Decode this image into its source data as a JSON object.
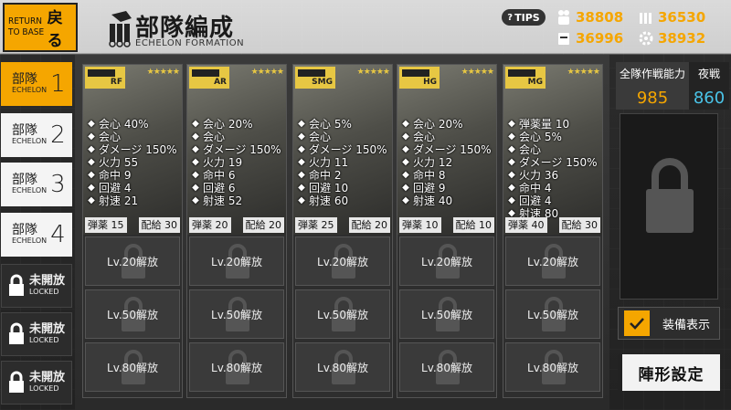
{
  "header": {
    "return_en": "RETURN TO BASE",
    "return_jp": "戻る",
    "title_jp": "部隊編成",
    "title_en": "ECHELON FORMATION",
    "tips": "TIPS"
  },
  "resources": [
    {
      "name": "manpower-icon",
      "value": "38808",
      "color": "#f5a600"
    },
    {
      "name": "ammo-icon",
      "value": "36530",
      "color": "#f5a600"
    },
    {
      "name": "rations-icon",
      "value": "36996",
      "color": "#f5a600"
    },
    {
      "name": "parts-icon",
      "value": "38932",
      "color": "#f5a600"
    }
  ],
  "echelons": [
    {
      "jp": "部隊",
      "en": "ECHELON",
      "num": "1"
    },
    {
      "jp": "部隊",
      "en": "ECHELON",
      "num": "2"
    },
    {
      "jp": "部隊",
      "en": "ECHELON",
      "num": "3"
    },
    {
      "jp": "部隊",
      "en": "ECHELON",
      "num": "4"
    }
  ],
  "locked_echelons": [
    {
      "jp": "未開放",
      "en": "LOCKED"
    },
    {
      "jp": "未開放",
      "en": "LOCKED"
    },
    {
      "jp": "未開放",
      "en": "LOCKED"
    }
  ],
  "dolls": [
    {
      "type": "RF",
      "stats": [
        "会心 40%",
        "会心",
        "ダメージ 150%",
        "火力 55",
        "命中 9",
        "回避 4",
        "射速 21"
      ],
      "ammo": "弾薬 15",
      "ration": "配給 30"
    },
    {
      "type": "AR",
      "stats": [
        "会心 20%",
        "会心",
        "ダメージ 150%",
        "火力 19",
        "命中 6",
        "回避 6",
        "射速 52"
      ],
      "ammo": "弾薬 20",
      "ration": "配給 20"
    },
    {
      "type": "SMG",
      "stats": [
        "会心 5%",
        "会心",
        "ダメージ 150%",
        "火力 11",
        "命中 2",
        "回避 10",
        "射速 60"
      ],
      "ammo": "弾薬 25",
      "ration": "配給 20"
    },
    {
      "type": "HG",
      "stats": [
        "会心 20%",
        "会心",
        "ダメージ 150%",
        "火力 12",
        "命中 8",
        "回避 9",
        "射速 40"
      ],
      "ammo": "弾薬 10",
      "ration": "配給 10"
    },
    {
      "type": "MG",
      "stats": [
        "弾薬量 10",
        "会心 5%",
        "会心",
        "ダメージ 150%",
        "火力 36",
        "命中 4",
        "回避 4",
        "射速 80"
      ],
      "ammo": "弾薬 40",
      "ration": "配給 30"
    }
  ],
  "slots": [
    "Lv.20解放",
    "Lv.50解放",
    "Lv.80解放"
  ],
  "right_panel": {
    "combat_label": "全隊作戦能力",
    "combat_value": "985",
    "night_label": "夜戦",
    "night_value": "860",
    "equip_label": "装備表示",
    "formation_label": "陣形設定"
  }
}
